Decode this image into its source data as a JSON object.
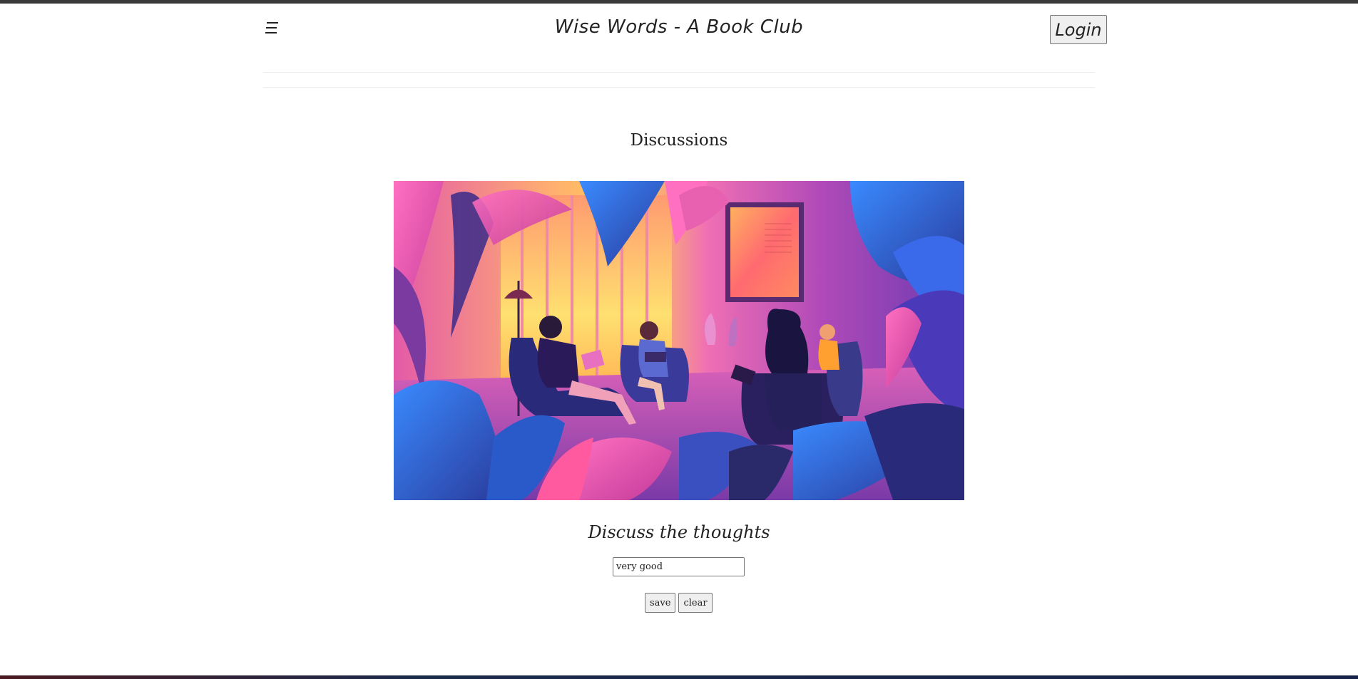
{
  "header": {
    "menu_icon": "hamburger-menu-icon",
    "title": "Wise Words - A Book Club",
    "login_label": "Login"
  },
  "main": {
    "section_title": "Discussions",
    "hero_image": "book-club-lounge-illustration",
    "subtitle": "Discuss the thoughts",
    "input_value": "very good",
    "save_label": "save",
    "clear_label": "clear"
  },
  "colors": {
    "background": "#ffffff",
    "top_strip": "#3a3a3a",
    "button_bg": "#efefef",
    "button_border": "#767676",
    "text": "#222222"
  }
}
